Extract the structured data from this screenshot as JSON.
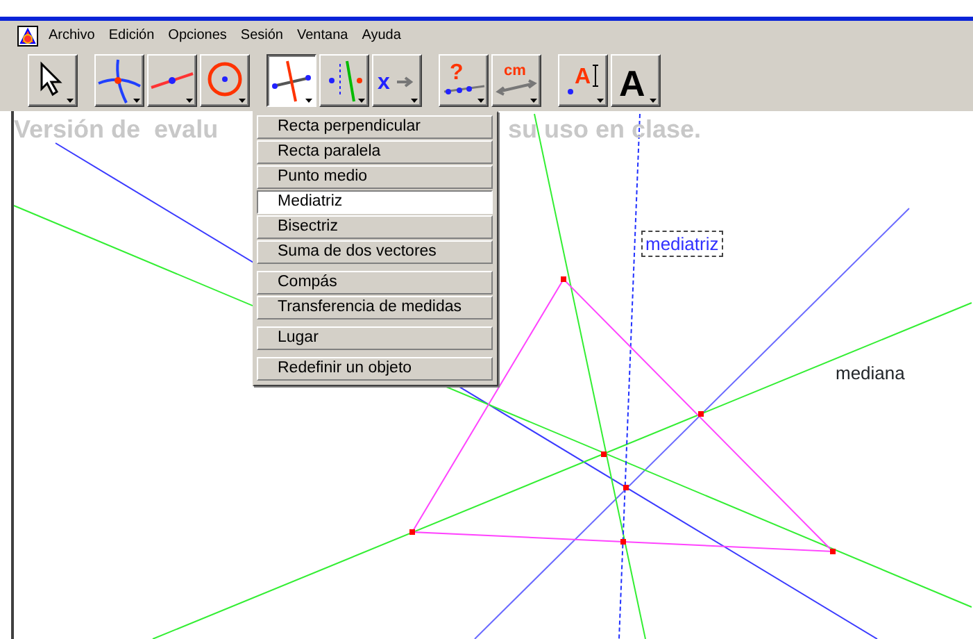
{
  "menubar": {
    "items": [
      "Archivo",
      "Edición",
      "Opciones",
      "Sesión",
      "Ventana",
      "Ayuda"
    ]
  },
  "toolbar": {
    "groups": [
      [
        {
          "kind": "pointer",
          "selected": false
        }
      ],
      [
        {
          "kind": "intersection",
          "selected": false
        },
        {
          "kind": "segment",
          "selected": false
        },
        {
          "kind": "circle",
          "selected": false
        }
      ],
      [
        {
          "kind": "perpendicular",
          "selected": true
        },
        {
          "kind": "parallel",
          "selected": false
        },
        {
          "kind": "transform",
          "selected": false,
          "glyph": "x"
        }
      ],
      [
        {
          "kind": "check",
          "selected": false,
          "glyph": "?"
        },
        {
          "kind": "measure",
          "selected": false,
          "glyph": "cm"
        }
      ],
      [
        {
          "kind": "label",
          "selected": false,
          "glyph": "A"
        },
        {
          "kind": "text",
          "selected": false,
          "glyph": "A"
        }
      ]
    ]
  },
  "canvas": {
    "notice_left": "Versión de  evalu",
    "notice_right": "su uso en clase.",
    "labels": [
      {
        "text": "mediatriz",
        "kind": "boxed"
      },
      {
        "text": "mediana",
        "kind": "plain"
      }
    ]
  },
  "dropdown": {
    "sections": [
      [
        {
          "label": "Recta perpendicular",
          "selected": false
        },
        {
          "label": "Recta paralela",
          "selected": false
        },
        {
          "label": "Punto medio",
          "selected": false
        },
        {
          "label": "Mediatriz",
          "selected": true
        },
        {
          "label": "Bisectriz",
          "selected": false
        },
        {
          "label": "Suma de dos vectores",
          "selected": false
        }
      ],
      [
        {
          "label": "Compás",
          "selected": false
        },
        {
          "label": "Transferencia de medidas",
          "selected": false
        }
      ],
      [
        {
          "label": "Lugar",
          "selected": false
        }
      ],
      [
        {
          "label": "Redefinir un objeto",
          "selected": false
        }
      ]
    ]
  }
}
